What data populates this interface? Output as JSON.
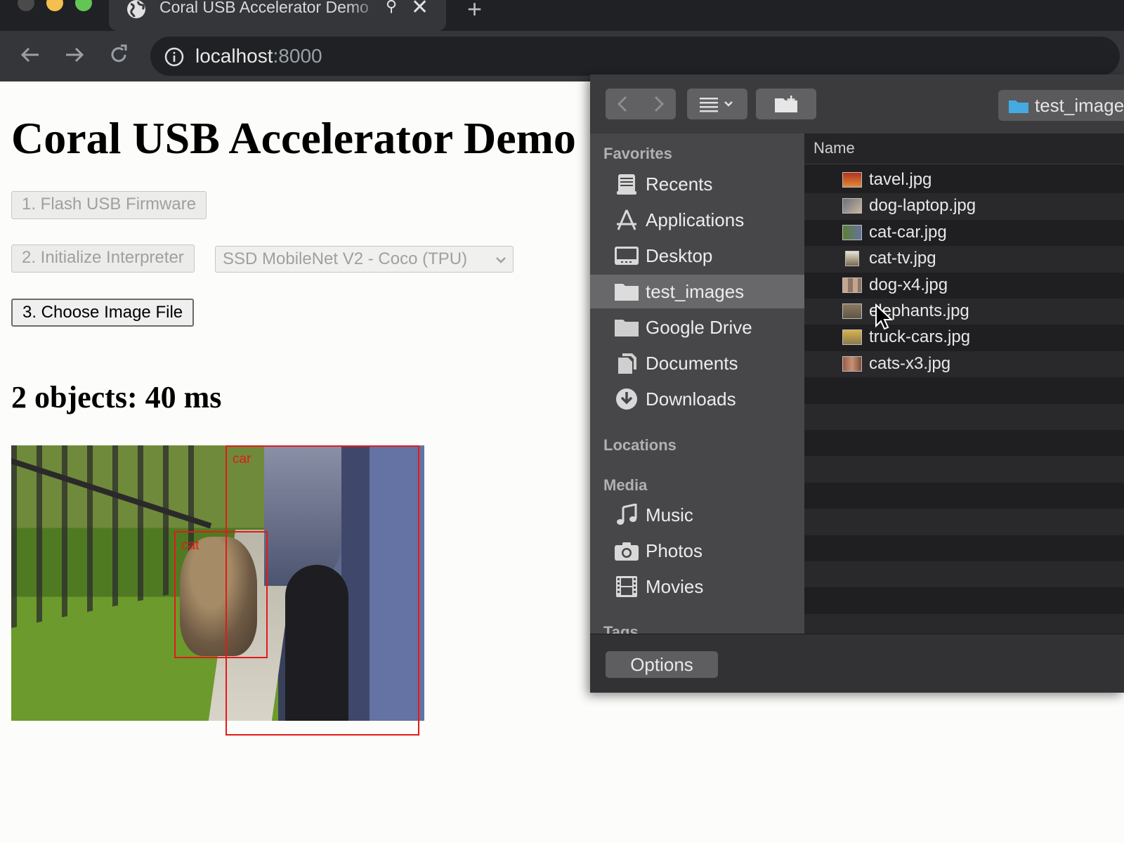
{
  "browser": {
    "tab_title": "Coral USB Accelerator Demo",
    "url_host": "localhost",
    "url_port": ":8000"
  },
  "page": {
    "title": "Coral USB Accelerator Demo",
    "flash_button": "1. Flash USB Firmware",
    "init_button": "2. Initialize Interpreter",
    "model_select": "SSD MobileNet V2 - Coco (TPU)",
    "choose_button": "3. Choose Image File",
    "result": "2 objects: 40 ms",
    "detections": [
      {
        "label": "car"
      },
      {
        "label": "cat"
      }
    ]
  },
  "dialog": {
    "path": "test_images",
    "sidebar": {
      "favorites_header": "Favorites",
      "favorites": [
        {
          "label": "Recents",
          "icon": "recents-icon"
        },
        {
          "label": "Applications",
          "icon": "applications-icon"
        },
        {
          "label": "Desktop",
          "icon": "desktop-icon"
        },
        {
          "label": "test_images",
          "icon": "folder-icon",
          "selected": true
        },
        {
          "label": "Google Drive",
          "icon": "folder-icon"
        },
        {
          "label": "Documents",
          "icon": "documents-icon"
        },
        {
          "label": "Downloads",
          "icon": "downloads-icon"
        }
      ],
      "locations_header": "Locations",
      "media_header": "Media",
      "media": [
        {
          "label": "Music",
          "icon": "music-icon"
        },
        {
          "label": "Photos",
          "icon": "camera-icon"
        },
        {
          "label": "Movies",
          "icon": "film-icon"
        }
      ],
      "tags_header": "Tags"
    },
    "column_header": "Name",
    "files": [
      "tavel.jpg",
      "dog-laptop.jpg",
      "cat-car.jpg",
      "cat-tv.jpg",
      "dog-x4.jpg",
      "elephants.jpg",
      "truck-cars.jpg",
      "cats-x3.jpg"
    ],
    "options_button": "Options"
  },
  "colors": {
    "detection_box": "#e31a1a",
    "sidebar_selected": "#68686b"
  }
}
